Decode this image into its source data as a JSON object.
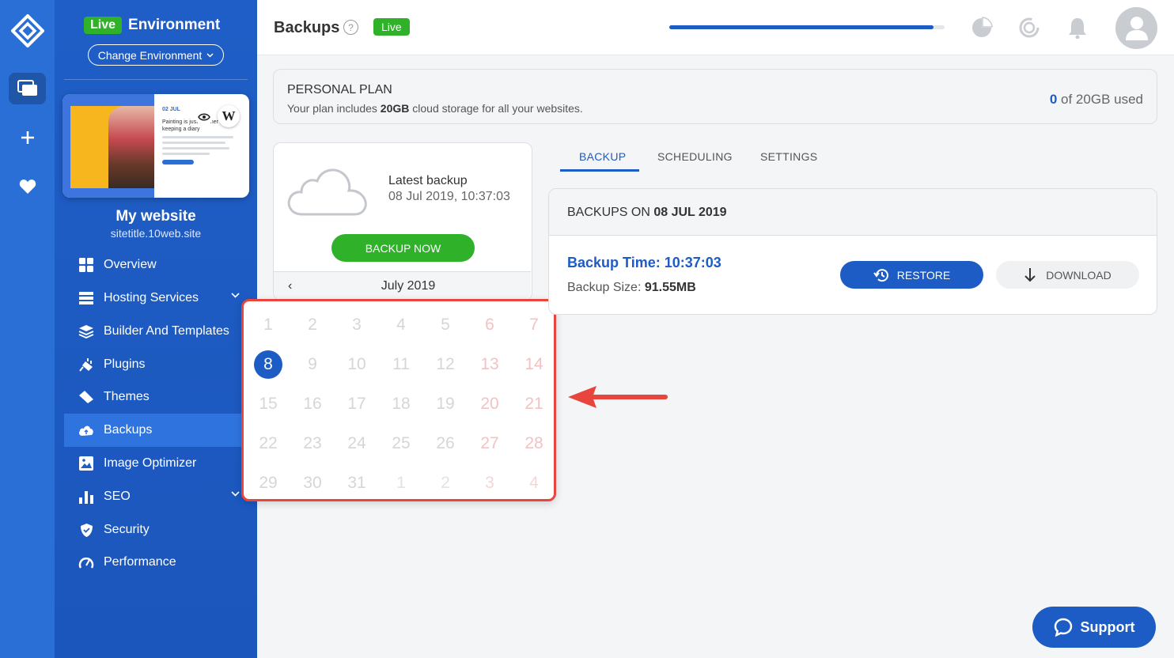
{
  "sidebar": {
    "env_badge": "Live",
    "env_label": "Environment",
    "change_env": "Change Environment",
    "site_name": "My website",
    "site_url": "sitetitle.10web.site",
    "thumb_date": "02 JUL",
    "thumb_text": "Painting is just another way of keeping a diary",
    "items": [
      {
        "label": "Overview",
        "icon": "grid-icon"
      },
      {
        "label": "Hosting Services",
        "icon": "server-icon",
        "has_chevron": true
      },
      {
        "label": "Builder And Templates",
        "icon": "layers-icon"
      },
      {
        "label": "Plugins",
        "icon": "plug-icon"
      },
      {
        "label": "Themes",
        "icon": "brush-icon"
      },
      {
        "label": "Backups",
        "icon": "cloud-upload-icon",
        "active": true
      },
      {
        "label": "Image Optimizer",
        "icon": "image-icon"
      },
      {
        "label": "SEO",
        "icon": "bar-chart-icon",
        "has_chevron": true
      },
      {
        "label": "Security",
        "icon": "shield-icon"
      },
      {
        "label": "Performance",
        "icon": "gauge-icon"
      }
    ]
  },
  "header": {
    "title": "Backups",
    "help": "?",
    "live_badge": "Live",
    "progress_fraction": 0.96
  },
  "plan": {
    "title": "PERSONAL PLAN",
    "desc_prefix": "Your plan includes ",
    "desc_amount": "20GB",
    "desc_suffix": " cloud storage for all your websites.",
    "usage_used": "0",
    "usage_rest": " of 20GB used"
  },
  "latest": {
    "label": "Latest backup",
    "date": "08 Jul 2019, 10:37:03",
    "backup_now": "BACKUP NOW"
  },
  "calendar": {
    "prev": "‹",
    "month": "July 2019",
    "selected": "8",
    "days": [
      {
        "d": "1"
      },
      {
        "d": "2"
      },
      {
        "d": "3"
      },
      {
        "d": "4"
      },
      {
        "d": "5"
      },
      {
        "d": "6",
        "wknd": true
      },
      {
        "d": "7",
        "wknd": true
      },
      {
        "d": "8",
        "sel": true
      },
      {
        "d": "9"
      },
      {
        "d": "10"
      },
      {
        "d": "11"
      },
      {
        "d": "12"
      },
      {
        "d": "13",
        "wknd": true
      },
      {
        "d": "14",
        "wknd": true
      },
      {
        "d": "15"
      },
      {
        "d": "16"
      },
      {
        "d": "17"
      },
      {
        "d": "18"
      },
      {
        "d": "19"
      },
      {
        "d": "20",
        "wknd": true
      },
      {
        "d": "21",
        "wknd": true
      },
      {
        "d": "22"
      },
      {
        "d": "23"
      },
      {
        "d": "24"
      },
      {
        "d": "25"
      },
      {
        "d": "26"
      },
      {
        "d": "27",
        "wknd": true
      },
      {
        "d": "28",
        "wknd": true
      },
      {
        "d": "29"
      },
      {
        "d": "30"
      },
      {
        "d": "31"
      },
      {
        "d": "1",
        "other": true
      },
      {
        "d": "2",
        "other": true
      },
      {
        "d": "3",
        "other": true,
        "wknd": true
      },
      {
        "d": "4",
        "other": true,
        "wknd": true
      }
    ]
  },
  "tabs": [
    {
      "label": "BACKUP",
      "active": true
    },
    {
      "label": "SCHEDULING"
    },
    {
      "label": "SETTINGS"
    }
  ],
  "backups": {
    "head_prefix": "BACKUPS ON ",
    "head_date": "08 JUL 2019",
    "time_label": "Backup Time: 10:37:03",
    "size_prefix": "Backup Size: ",
    "size_value": "91.55MB",
    "restore": "RESTORE",
    "download": "DOWNLOAD"
  },
  "support": "Support",
  "colors": {
    "primary": "#1c5cc4",
    "sidebar": "#1f5ec6",
    "rail": "#2a6fd6",
    "success": "#2fb12a",
    "annotation": "#e8453c"
  }
}
